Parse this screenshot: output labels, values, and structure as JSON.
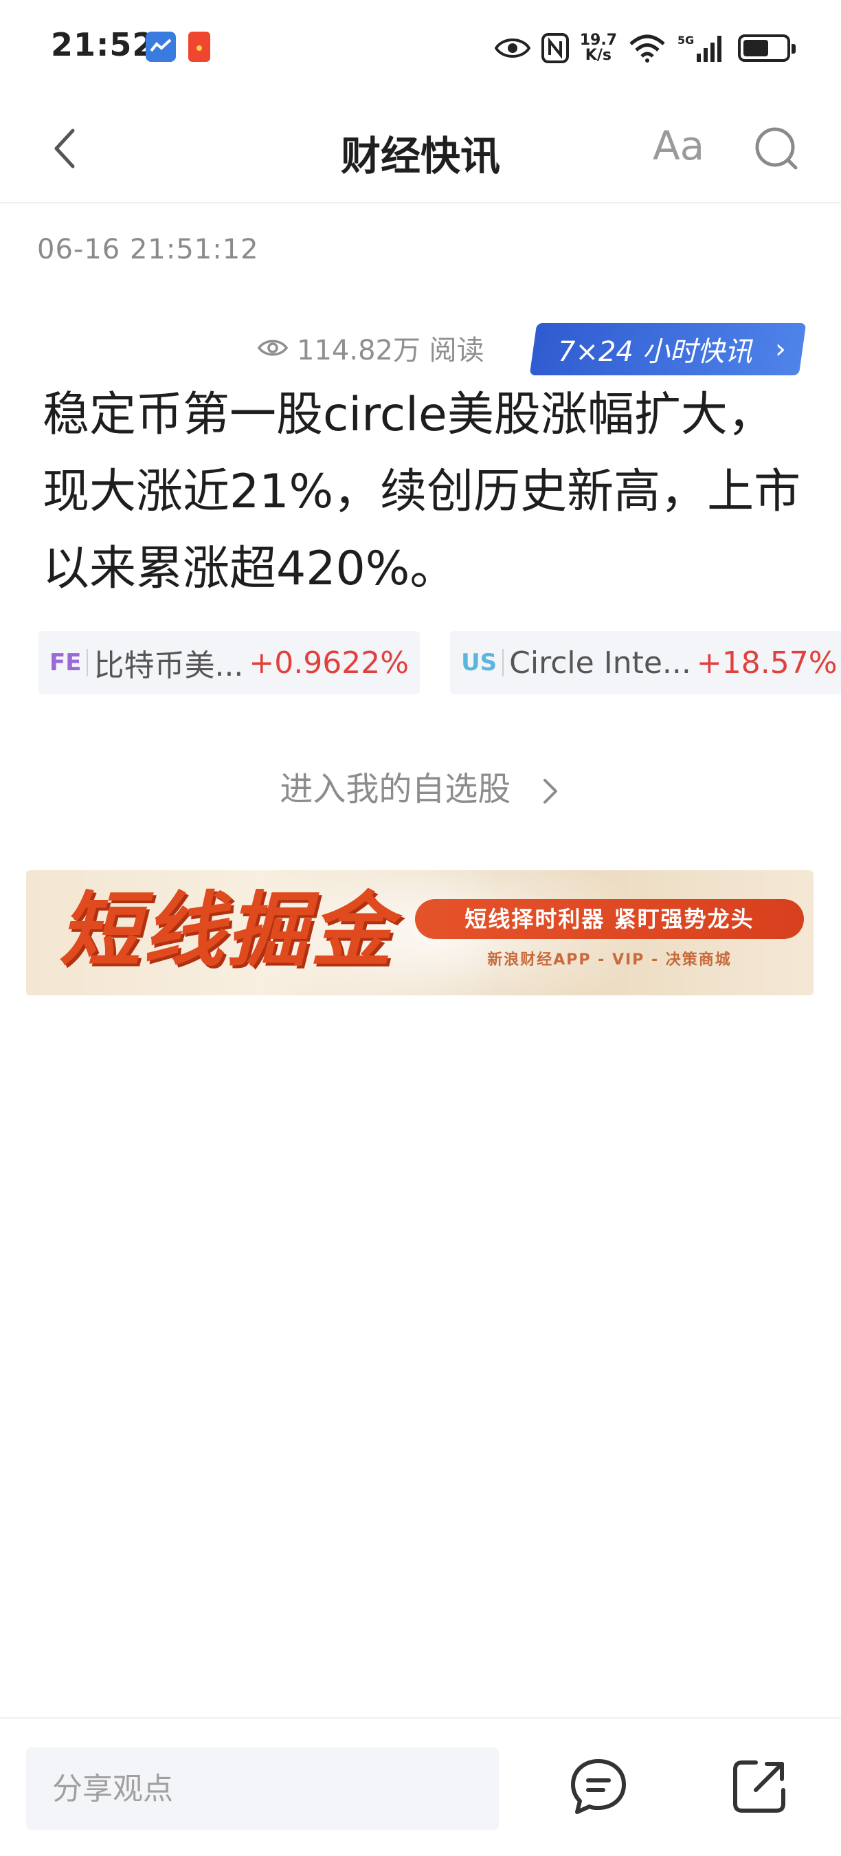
{
  "status_bar": {
    "time": "21:52",
    "net_speed_value": "19.7",
    "net_speed_unit": "K/s",
    "network": "5G",
    "battery_level": 0.6
  },
  "nav": {
    "title": "财经快讯",
    "font_button": "Aa"
  },
  "article": {
    "datetime": "06-16 21:51:12",
    "read_count": "114.82万 阅读",
    "badge_label": "7×24 小时快讯",
    "headline": "稳定币第一股circle美股涨幅扩大，现大涨近21%，续创历史新高，上市以来累涨超420%。"
  },
  "stocks": [
    {
      "tag": "FE",
      "name": "比特币美...",
      "change": "+0.9622%"
    },
    {
      "tag": "US",
      "name": "Circle Inte...",
      "change": "+18.57%"
    }
  ],
  "enter_watchlist": "进入我的自选股",
  "banner": {
    "title": "短线掘金",
    "slogan": "短线择时利器  紧盯强势龙头",
    "sub": "新浪财经APP - VIP - 决策商城"
  },
  "bottom": {
    "share_placeholder": "分享观点"
  },
  "colors": {
    "accent_blue": "#3a6ad8",
    "rise_red": "#e0413c"
  }
}
